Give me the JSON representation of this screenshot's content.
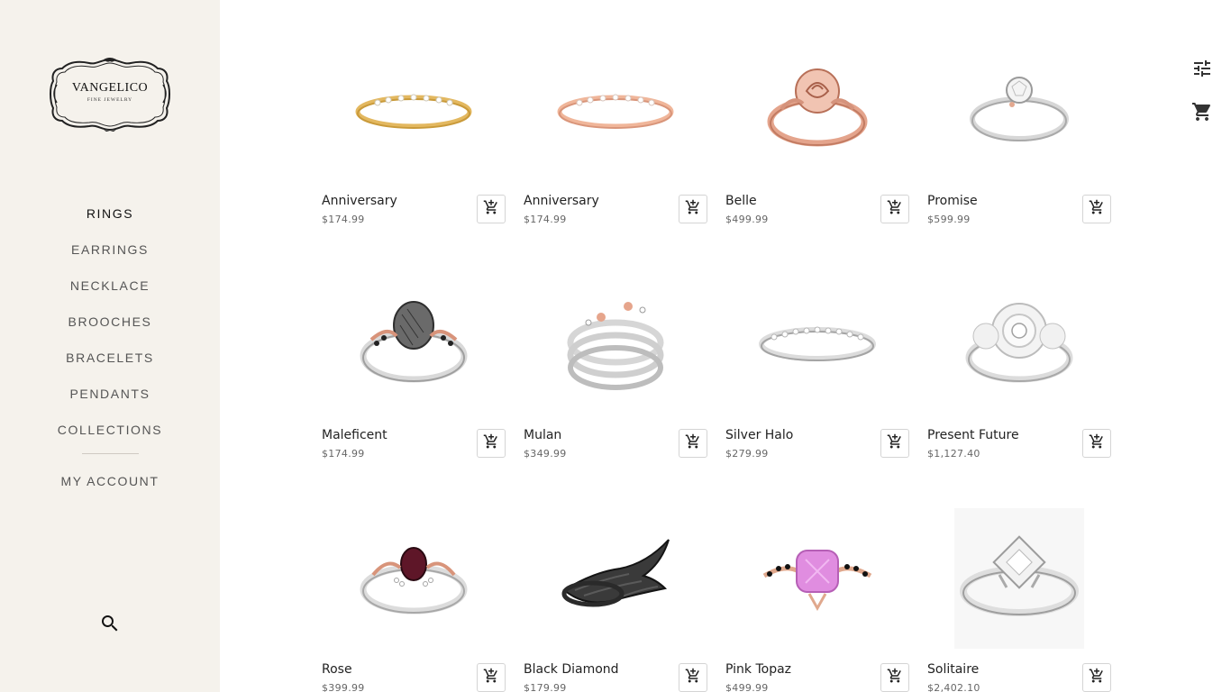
{
  "brand": {
    "name": "VANGELICO",
    "tagline": "FINE JEWELRY"
  },
  "nav": {
    "items": [
      {
        "label": "RINGS",
        "active": true
      },
      {
        "label": "EARRINGS"
      },
      {
        "label": "NECKLACE"
      },
      {
        "label": "BROOCHES"
      },
      {
        "label": "BRACELETS"
      },
      {
        "label": "PENDANTS"
      },
      {
        "label": "COLLECTIONS"
      }
    ],
    "account_label": "MY ACCOUNT"
  },
  "icons": {
    "search": "search-icon",
    "filter": "tune-icon",
    "cart": "shopping-cart-icon",
    "add_to_cart": "add-shopping-cart-icon"
  },
  "colors": {
    "sidebar_bg": "#f5f2ec",
    "text": "#222222",
    "muted": "#666666"
  },
  "products": [
    {
      "name": "Anniversary",
      "price": "$174.99",
      "metal": "yellow-gold"
    },
    {
      "name": "Anniversary",
      "price": "$174.99",
      "metal": "rose-gold"
    },
    {
      "name": "Belle",
      "price": "$499.99",
      "metal": "rose-gold"
    },
    {
      "name": "Promise",
      "price": "$599.99",
      "metal": "silver"
    },
    {
      "name": "Maleficent",
      "price": "$174.99",
      "metal": "silver"
    },
    {
      "name": "Mulan",
      "price": "$349.99",
      "metal": "silver"
    },
    {
      "name": "Silver Halo",
      "price": "$279.99",
      "metal": "silver"
    },
    {
      "name": "Present Future",
      "price": "$1,127.40",
      "metal": "silver"
    },
    {
      "name": "Rose",
      "price": "$399.99",
      "metal": "silver"
    },
    {
      "name": "Black Diamond",
      "price": "$179.99",
      "metal": "black"
    },
    {
      "name": "Pink Topaz",
      "price": "$499.99",
      "metal": "rose-gold"
    },
    {
      "name": "Solitaire",
      "price": "$2,402.10",
      "metal": "silver"
    }
  ]
}
